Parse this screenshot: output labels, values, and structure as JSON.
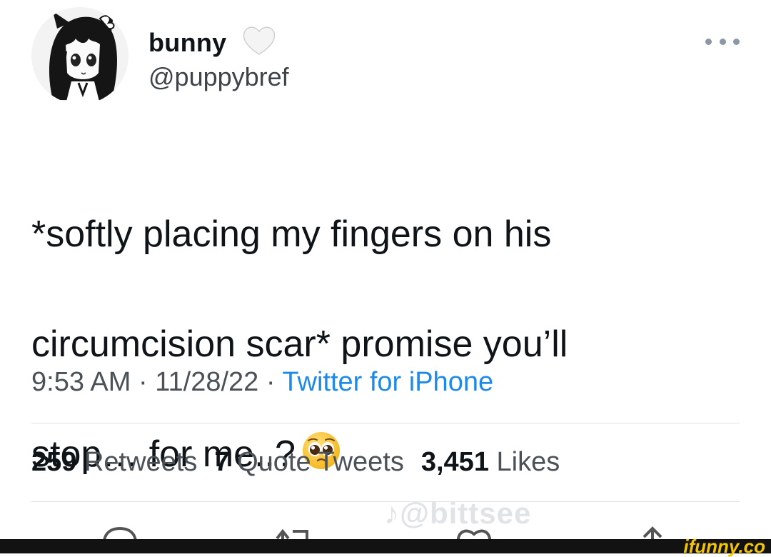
{
  "tweet": {
    "author": {
      "display_name": "bunny",
      "handle": "@puppybref",
      "avatar_icon": "anime-girl-avatar",
      "name_badge_icon": "white-heart-icon"
    },
    "text_lines": [
      "*softly placing my fingers on his",
      "circumcision scar* promise you’ll",
      "stop… for me..?"
    ],
    "text_emoji": "pleading-face-emoji",
    "time": "9:53 AM",
    "date": "11/28/22",
    "separator": "·",
    "source": "Twitter for iPhone",
    "stats": {
      "retweets_count": "259",
      "retweets_label": "Retweets",
      "quote_tweets_count": "7",
      "quote_tweets_label": "Quote Tweets",
      "likes_count": "3,451",
      "likes_label": "Likes"
    },
    "actions": [
      "reply-icon",
      "retweet-icon",
      "like-icon",
      "share-icon"
    ]
  },
  "overlay": {
    "watermark_text": "@bittsee",
    "watermark_icon": "tiktok-icon",
    "site_logo": "ifunny.co"
  },
  "colors": {
    "text": "#0f1419",
    "secondary_text": "#4a5157",
    "link": "#1d8ae6",
    "divider": "#dfe3e6",
    "logo": "#f5c400",
    "bar": "#121212"
  }
}
